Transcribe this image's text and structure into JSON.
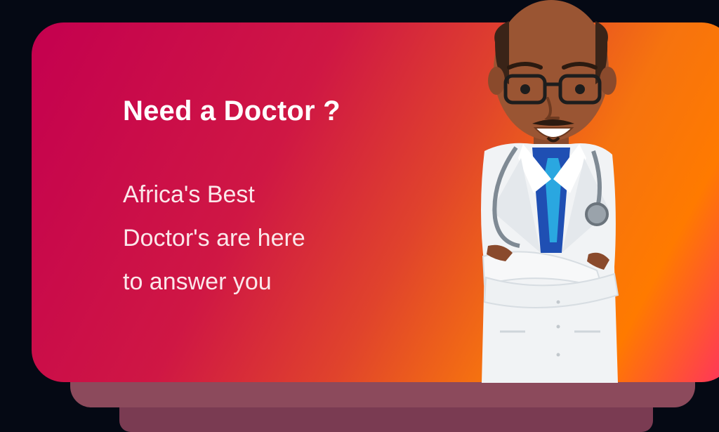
{
  "banner": {
    "title": "Need a Doctor ?",
    "subtitle_lines": [
      "Africa's Best",
      "Doctor's are here",
      "to answer you"
    ]
  },
  "illustration": {
    "icon": "doctor-illustration"
  },
  "colors": {
    "background": "#050914",
    "gradient_start": "#c4004f",
    "gradient_mid": "#e0432c",
    "gradient_end": "#ff7a00",
    "text": "#ffffff"
  }
}
